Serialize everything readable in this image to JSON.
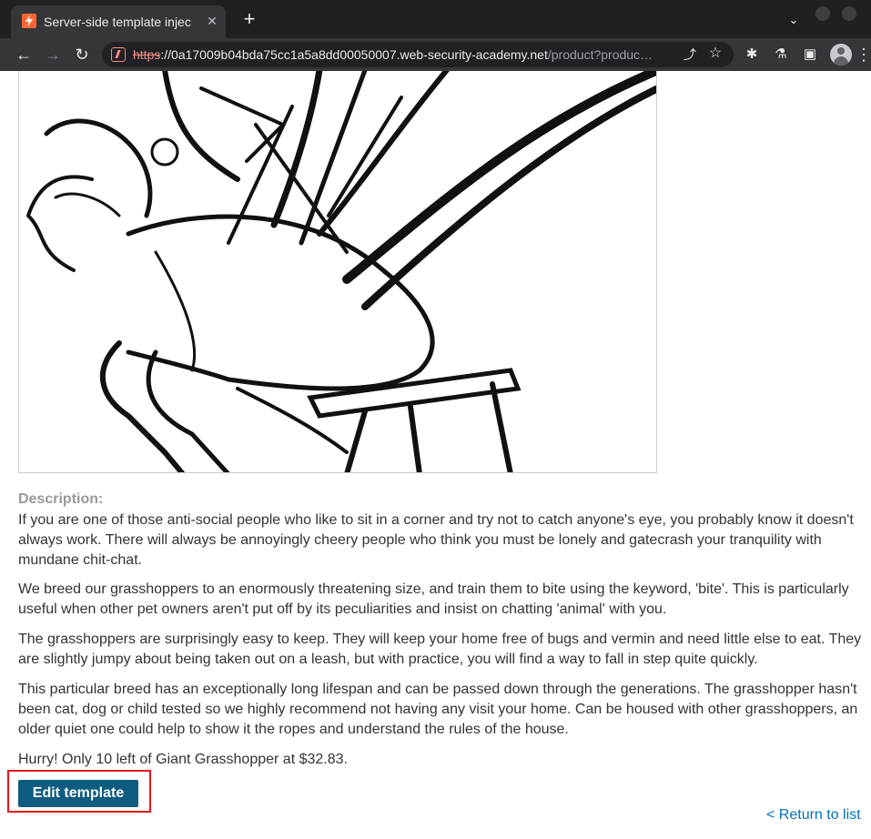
{
  "browser": {
    "tab_title": "Server-side template injec",
    "tab_close": "✕",
    "new_tab": "+",
    "tab_search": "⌄",
    "url_scheme": "https",
    "url_host": "://0a17009b04bda75cc1a5a8dd00050007.web-security-academy.net",
    "url_path": "/product?produc…",
    "back_icon": "←",
    "forward_icon": "→",
    "reload_icon": "↻",
    "share_icon": "⤴",
    "star_icon": "☆",
    "extensions_icon": "✱",
    "labs_icon": "⚗",
    "sidepanel_icon": "▣",
    "menu_icon": "⋮"
  },
  "product": {
    "description_label": "Description:",
    "paragraphs": [
      "If you are one of those anti-social people who like to sit in a corner and try not to catch anyone's eye, you probably know it doesn't always work. There will always be annoyingly cheery people who think you must be lonely and gatecrash your tranquility with mundane chit-chat.",
      "We breed our grasshoppers to an enormously threatening size, and train them to bite using the keyword, 'bite'. This is particularly useful when other pet owners aren't put off by its peculiarities and insist on chatting 'animal' with you.",
      "The grasshoppers are surprisingly easy to keep. They will keep your home free of bugs and vermin and need little else to eat. They are slightly jumpy about being taken out on a leash, but with practice, you will find a way to fall in step quite quickly.",
      "This particular breed has an exceptionally long lifespan and can be passed down through the generations. The grasshopper hasn't been cat, dog or child tested so we highly recommend not having any visit your home. Can be housed with other grasshoppers, an older quiet one could help to show it the ropes and understand the rules of the house."
    ],
    "stock_message": "Hurry! Only 10 left of Giant Grasshopper at $32.83.",
    "edit_template_label": "Edit template",
    "return_link": "< Return to list"
  },
  "colors": {
    "accent_button": "#0e5c80",
    "highlight_box": "#e8161d",
    "link": "#0071bc",
    "favicon": "#ff6633"
  }
}
